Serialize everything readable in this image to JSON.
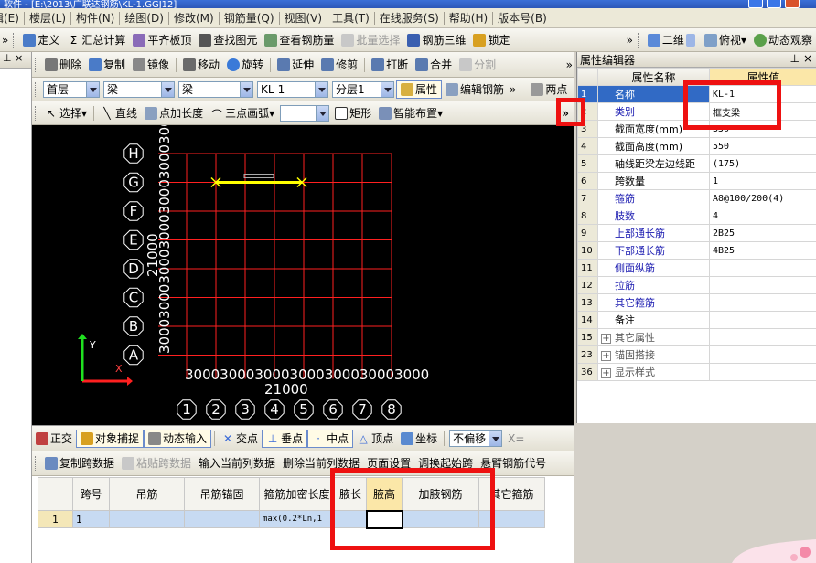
{
  "title": {
    "text": "软件 - [E:\\2013\\广联达钢筋\\KL-1.GGJ12]"
  },
  "menu": [
    "编辑(E)",
    "楼层(L)",
    "构件(N)",
    "绘图(D)",
    "修改(M)",
    "钢筋量(Q)",
    "视图(V)",
    "工具(T)",
    "在线服务(S)",
    "帮助(H)",
    "版本号(B)"
  ],
  "toolbar1": {
    "items": [
      "定义",
      "汇总计算",
      "平齐板顶",
      "查找图元",
      "查看钢筋量",
      "批量选择",
      "钢筋三维",
      "锁定"
    ],
    "view_items": [
      "二维",
      "俯视",
      "动态观察"
    ]
  },
  "toolbar2": {
    "items": [
      "删除",
      "复制",
      "镜像",
      "移动",
      "旋转",
      "延伸",
      "修剪",
      "打断",
      "合并",
      "分割"
    ]
  },
  "toolbar3": {
    "floor": "首层",
    "category": "梁",
    "type": "梁",
    "name": "KL-1",
    "layer": "分层1",
    "attr_btn": "属性",
    "edit_rebar": "编辑钢筋",
    "two_point": "两点"
  },
  "toolbar4": {
    "items": [
      "选择",
      "直线",
      "点加长度",
      "三点画弧",
      "矩形",
      "智能布置"
    ],
    "more": "»"
  },
  "canvas": {
    "rows": [
      "H",
      "G",
      "F",
      "E",
      "D",
      "C",
      "B",
      "A"
    ],
    "cols": [
      "1",
      "2",
      "3",
      "4",
      "5",
      "6",
      "7",
      "8"
    ],
    "left_dim_total": "21000",
    "left_dim_segments": "3000300030003000300030003000",
    "bottom_dim_total": "21000",
    "bottom_dim_segments": "3000300030003000300030003000",
    "axis_x": "X",
    "axis_y": "Y",
    "colors": {
      "grid": "#ff2020",
      "beam": "#ffff00",
      "axis_x": "#ff2020",
      "axis_y": "#20e020",
      "bubble": "#ffffff"
    }
  },
  "snapbar": {
    "items": [
      "正交",
      "对象捕捉",
      "动态输入",
      "交点",
      "垂点",
      "中点",
      "顶点",
      "坐标"
    ],
    "offset": "不偏移",
    "x_label": "X="
  },
  "property_editor": {
    "title": "属性编辑器",
    "col_name": "属性名称",
    "col_value": "属性值",
    "rows": [
      {
        "num": "1",
        "name": "名称",
        "value": "KL-1",
        "blue": true,
        "selected": true
      },
      {
        "num": "2",
        "name": "类别",
        "value": "框支梁",
        "blue": true
      },
      {
        "num": "3",
        "name": "截面宽度(mm)",
        "value": "350"
      },
      {
        "num": "4",
        "name": "截面高度(mm)",
        "value": "550"
      },
      {
        "num": "5",
        "name": "轴线距梁左边线距",
        "value": "(175)"
      },
      {
        "num": "6",
        "name": "跨数量",
        "value": "1"
      },
      {
        "num": "7",
        "name": "箍筋",
        "value": "A8@100/200(4)",
        "blue": true
      },
      {
        "num": "8",
        "name": "肢数",
        "value": "4",
        "blue": true
      },
      {
        "num": "9",
        "name": "上部通长筋",
        "value": "2B25",
        "blue": true
      },
      {
        "num": "10",
        "name": "下部通长筋",
        "value": "4B25",
        "blue": true
      },
      {
        "num": "11",
        "name": "侧面纵筋",
        "value": "",
        "blue": true
      },
      {
        "num": "12",
        "name": "拉筋",
        "value": "",
        "blue": true
      },
      {
        "num": "13",
        "name": "其它箍筋",
        "value": "",
        "blue": true
      },
      {
        "num": "14",
        "name": "备注",
        "value": ""
      },
      {
        "num": "15",
        "name": "其它属性",
        "value": "",
        "group": true
      },
      {
        "num": "23",
        "name": "锚固搭接",
        "value": "",
        "group": true
      },
      {
        "num": "36",
        "name": "显示样式",
        "value": "",
        "group": true
      }
    ]
  },
  "bottom_toolbar": {
    "items": [
      "复制跨数据",
      "粘贴跨数据",
      "输入当前列数据",
      "删除当前列数据",
      "页面设置",
      "调换起始跨",
      "悬臂钢筋代号"
    ]
  },
  "span_table": {
    "headers": [
      "跨号",
      "吊筋",
      "吊筋锚固",
      "箍筋加密长度",
      "腋长",
      "腋高",
      "加腋钢筋",
      "其它箍筋"
    ],
    "row": {
      "num": "1",
      "span": "1",
      "stirrup_dense": "max(0.2*Ln,1"
    }
  }
}
